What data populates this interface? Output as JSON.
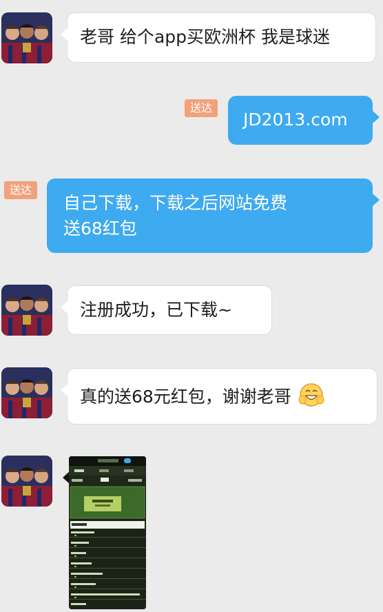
{
  "colors": {
    "background": "#ebebeb",
    "outgoing_bubble": "#3eaaf0",
    "status_badge": "#f2a27b"
  },
  "messages": [
    {
      "direction": "incoming",
      "text": "老哥 给个app买欧洲杯 我是球迷"
    },
    {
      "direction": "outgoing",
      "status": "送达",
      "text": "JD2013.com"
    },
    {
      "direction": "outgoing",
      "status": "送达",
      "line1": "自己下载，下载之后网站免费",
      "line2": "送68红包"
    },
    {
      "direction": "incoming",
      "text": "注册成功，已下载~"
    },
    {
      "direction": "incoming",
      "text": "真的送68元红包，谢谢老哥",
      "emoji": "grinning-face-emoji"
    },
    {
      "direction": "incoming",
      "type": "image"
    }
  ]
}
